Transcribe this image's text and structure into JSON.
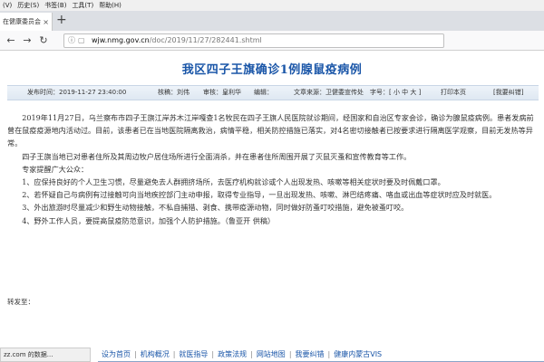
{
  "browser": {
    "menu": [
      "(V)",
      "历史(S)",
      "书签(B)",
      "工具(T)",
      "帮助(H)"
    ],
    "tab_title": "在健康委员会",
    "url_domain": "wjw.nmg.gov.cn",
    "url_path": "/doc/2019/11/27/282441.shtml"
  },
  "article": {
    "title": "我区四子王旗确诊1例腺鼠疫病例",
    "publish_time": "发布时间：2019-11-27 23:40:00",
    "author": "核稿：刘伟",
    "reviewer": "审核：皇利华",
    "editor": "编辑：",
    "source": "文章来源：卫健委宣传处",
    "font_size": "字号：[ 小 中 大 ]",
    "print_label": "打印本页",
    "error_label": "[我要纠错]",
    "paragraphs": [
      "2019年11月27日，乌兰察布市四子王旗江岸苏木江岸嘎查1名牧民在四子王旗人民医院就诊期间，经国家和自治区专家会诊，确诊为腺鼠疫病例。患者发病前曾在鼠疫疫源地内活动过。目前，该患者已在当地医院隔离救治，病情平稳，相关防控措施已落实，对4名密切接触者已按要求进行隔离医学观察，目前无发热等异常。",
      "四子王旗当地已对患者住所及其周边牧户居住场所进行全面消杀，并在患者住所周围开展了灭鼠灭蚤和宣传教育等工作。",
      "专家提醒广大公众：",
      "1、应保持良好的个人卫生习惯，尽量避免去人群拥挤场所，去医疗机构就诊或个人出现发热、咳嗽等相关症状时要及时佩戴口罩。",
      "2、若怀疑自己与病例有过接触可向当地疾控部门主动申报，取得专业指导，一旦出现发热、咳嗽、淋巴结疼痛、咯血或出血等症状时应及时就医。",
      "3、外出旅游时尽量减少和野生动物接触，不私自捕猎、剥食、携带疫源动物，同时做好防蚤叮咬措施，避免被蚤叮咬。",
      "4、野外工作人员，要提高鼠疫防范意识，加强个人防护措施。（鲁亚开 供稿）"
    ],
    "share_label": "转发至："
  },
  "status_text": "zz.com 的数据...",
  "footer": [
    "设为首页",
    "机构概况",
    "就医指导",
    "政策法规",
    "网站地图",
    "我要纠错",
    "健康内蒙古VIS"
  ]
}
